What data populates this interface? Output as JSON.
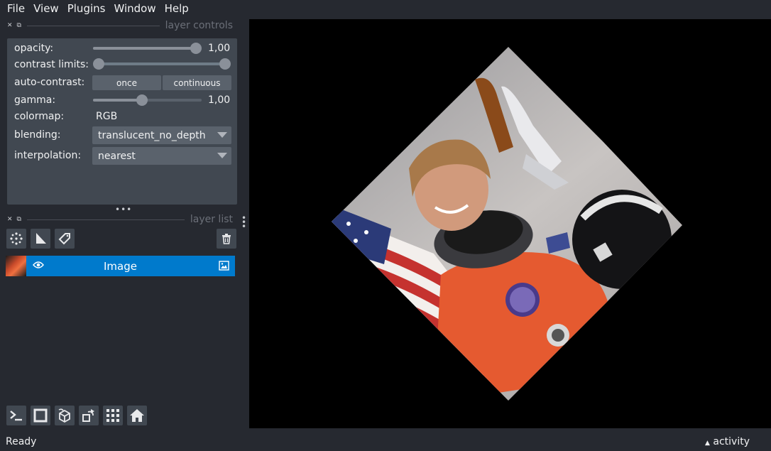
{
  "menu": {
    "file": "File",
    "view": "View",
    "plugins": "Plugins",
    "window": "Window",
    "help": "Help"
  },
  "layer_controls": {
    "title": "layer controls",
    "opacity_label": "opacity:",
    "opacity_value": "1,00",
    "opacity_level": 1.0,
    "contrast_label": "contrast limits:",
    "contrast_range": [
      0,
      1
    ],
    "auto_contrast_label": "auto-contrast:",
    "once_label": "once",
    "continuous_label": "continuous",
    "gamma_label": "gamma:",
    "gamma_value": "1,00",
    "gamma_level": 0.5,
    "colormap_label": "colormap:",
    "colormap_value": "RGB",
    "blending_label": "blending:",
    "blending_value": "translucent_no_depth",
    "interpolation_label": "interpolation:",
    "interpolation_value": "nearest"
  },
  "layer_list": {
    "title": "layer list",
    "layers": [
      {
        "name": "Image",
        "visible": true,
        "selected": true
      }
    ]
  },
  "icons": {
    "new_points": "points-icon",
    "new_shapes": "shapes-icon",
    "new_labels": "labels-tag-icon",
    "delete": "trash-icon",
    "console": "console-icon",
    "ndisplay": "square-icon",
    "roll": "cube-icon",
    "transpose": "transpose-icon",
    "grid": "grid-icon",
    "home": "home-icon"
  },
  "colors": {
    "background": "#262930",
    "panel": "#414851",
    "accent": "#007acc",
    "canvas": "#000000"
  },
  "status": {
    "text": "Ready",
    "activity": "activity"
  }
}
